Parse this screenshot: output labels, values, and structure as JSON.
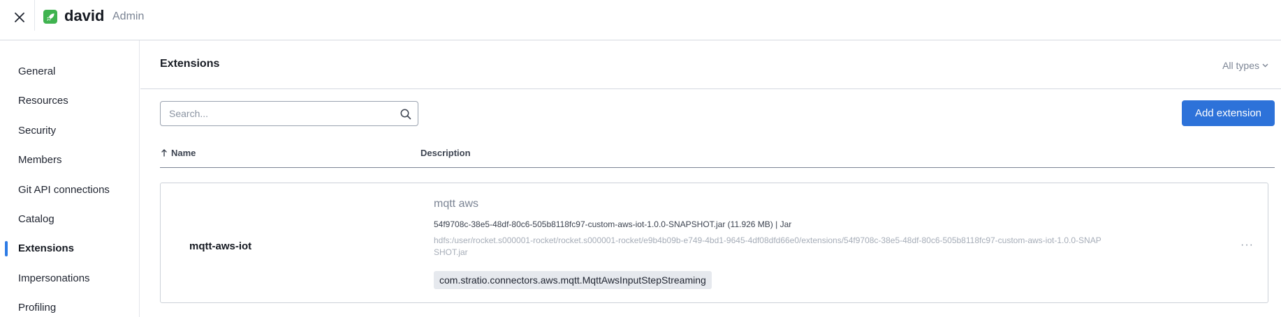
{
  "header": {
    "app_name": "david",
    "role": "Admin"
  },
  "sidebar": {
    "items": [
      {
        "label": "General"
      },
      {
        "label": "Resources"
      },
      {
        "label": "Security"
      },
      {
        "label": "Members"
      },
      {
        "label": "Git API connections"
      },
      {
        "label": "Catalog"
      },
      {
        "label": "Extensions",
        "active": true
      },
      {
        "label": "Impersonations"
      },
      {
        "label": "Profiling"
      }
    ]
  },
  "main": {
    "title": "Extensions",
    "type_filter": "All types",
    "search": {
      "placeholder": "Search...",
      "value": ""
    },
    "add_button": "Add extension",
    "columns": {
      "name": "Name",
      "description": "Description"
    },
    "extensions": [
      {
        "name": "mqtt-aws-iot",
        "title": "mqtt aws",
        "file": "54f9708c-38e5-48df-80c6-505b8118fc97-custom-aws-iot-1.0.0-SNAPSHOT.jar (11.926 MB) | Jar",
        "path": "hdfs:/user/rocket.s000001-rocket/rocket.s000001-rocket/e9b4b09b-e749-4bd1-9645-4df08dfd66e0/extensions/54f9708c-38e5-48df-80c6-505b8118fc97-custom-aws-iot-1.0.0-SNAPSHOT.jar",
        "class_name": "com.stratio.connectors.aws.mqtt.MqttAwsInputStepStreaming",
        "more": "···"
      }
    ]
  },
  "colors": {
    "accent": "#2d72d9",
    "logo_green": "#3fb34f",
    "active_indicator": "#2d7be5"
  },
  "icons": {
    "close": "close-icon",
    "logo": "rocket-icon",
    "search": "search-icon",
    "sort": "arrow-up-icon",
    "dropdown": "chevron-down-icon",
    "more": "more-icon"
  }
}
